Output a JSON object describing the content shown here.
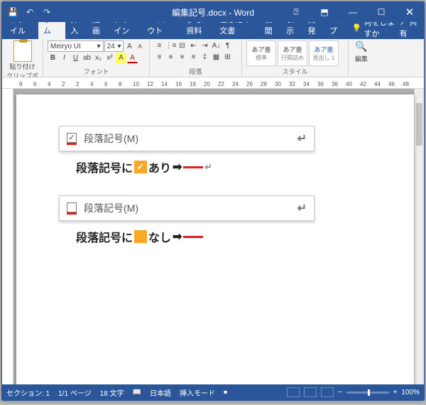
{
  "title": "編集記号.docx - Word",
  "qa": {
    "save": "💾",
    "undo": "↶",
    "redo": "↷"
  },
  "tabs": [
    "ファイル",
    "ホーム",
    "挿入",
    "描画",
    "デザイン",
    "レイアウト",
    "参考資料",
    "差し込み文書",
    "校閲",
    "表示",
    "開発",
    "ヘルプ"
  ],
  "tell_me": "何をしますか",
  "share": "共有",
  "ribbon": {
    "paste": "貼り付け",
    "clipboard": "クリップボード",
    "font_name": "Meiryo UI",
    "font_size": "24",
    "font_group": "フォント",
    "para_group": "段落",
    "style_group": "スタイル",
    "style_sample": "あア亜",
    "style1": "標準",
    "style2": "行間詰め",
    "style3": "見出し 1",
    "edit_btn": "編集"
  },
  "ruler_nums": [
    "8",
    "6",
    "4",
    "2",
    "2",
    "4",
    "6",
    "8",
    "10",
    "12",
    "14",
    "16",
    "18",
    "20",
    "22",
    "24",
    "26",
    "28",
    "30",
    "32",
    "34",
    "36",
    "38",
    "40",
    "42",
    "44",
    "46",
    "48"
  ],
  "doc": {
    "opt_checked_label": "段落記号(M)",
    "opt_unchecked_label": "段落記号(M)",
    "result_on_prefix": "段落記号に",
    "result_on_text": "あり",
    "check": "✓",
    "pilcrow": "↵",
    "result_off_prefix": "段落記号に",
    "result_off_text": "なし",
    "arrow": "➡"
  },
  "status": {
    "section": "セクション: 1",
    "page": "1/1 ページ",
    "words": "18 文字",
    "lang_icon": "📖",
    "lang": "日本語",
    "mode": "挿入モード",
    "rec": "⏺",
    "zoom": "100%"
  }
}
